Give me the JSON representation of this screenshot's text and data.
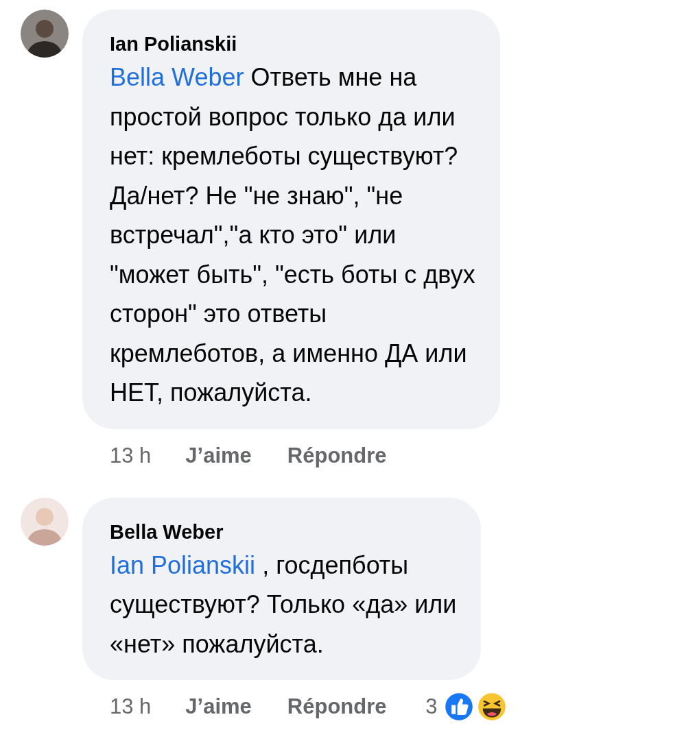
{
  "comments": [
    {
      "author": "Ian Polianskii",
      "mention": "Bella Weber",
      "text": " Ответь мне на\nпростой вопрос только да или\nнет: кремлеботы существуют?\nДа/нет?  Не \"не знаю\", \"не\nвстречал\",\"а кто это\" или\n\"может быть\", \"есть боты с двух\nсторон\" это ответы\nкремлеботов, а именно ДА или\nНЕТ, пожалуйста.",
      "time": "13 h",
      "like": "J’aime",
      "reply": "Répondre"
    },
    {
      "author": "Bella Weber",
      "mention": "Ian Polianskii",
      "text": " , госдепботы\nсуществуют? Только «да» или\n«нет» пожалуйста.",
      "time": "13 h",
      "like": "J’aime",
      "reply": "Répondre",
      "reaction_count": "3",
      "reactions": [
        {
          "kind": "like"
        },
        {
          "kind": "haha"
        }
      ]
    }
  ]
}
